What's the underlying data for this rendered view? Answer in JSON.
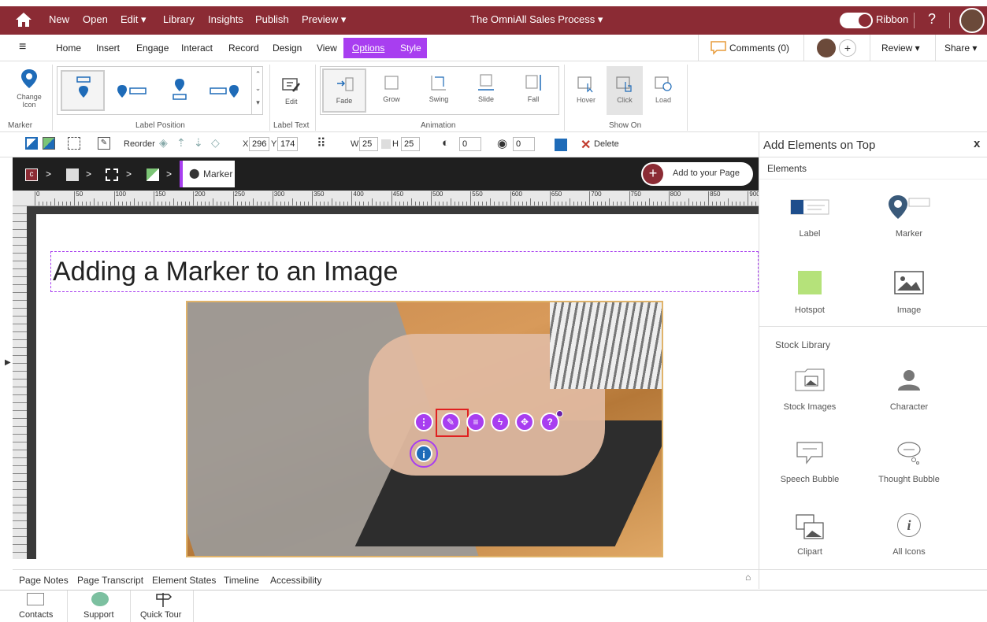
{
  "topbar": {
    "new": "New",
    "open": "Open",
    "edit": "Edit ▾",
    "library": "Library",
    "insights": "Insights",
    "publish": "Publish",
    "preview": "Preview ▾",
    "title": "The OmniAll Sales Process ▾",
    "ribbon": "Ribbon",
    "help": "?",
    "brand_color": "#8b2b34"
  },
  "tabs": {
    "home": "Home",
    "insert": "Insert",
    "engage": "Engage",
    "interact": "Interact",
    "record": "Record",
    "design": "Design",
    "view": "View",
    "options": "Options",
    "style": "Style",
    "comments": "Comments (0)",
    "review": "Review ▾",
    "share": "Share ▾",
    "accent": "#a83ef0"
  },
  "ribbon": {
    "change_icon": "Change Icon",
    "marker": "Marker",
    "label_position": "Label Position",
    "edit": "Edit",
    "label_text": "Label Text",
    "fade": "Fade",
    "grow": "Grow",
    "swing": "Swing",
    "slide": "Slide",
    "fall": "Fall",
    "animation": "Animation",
    "hover": "Hover",
    "click": "Click",
    "load": "Load",
    "show_on": "Show On"
  },
  "toolbar": {
    "reorder": "Reorder",
    "x_label": "X",
    "x": "296",
    "y_label": "Y",
    "y": "174",
    "w_label": "W",
    "w": "25",
    "h_label": "H",
    "h": "25",
    "opacity": "0",
    "rotate": "0",
    "delete": "Delete"
  },
  "crumb": {
    "marker": "Marker",
    "add": "Add to your Page"
  },
  "ruler": [
    "0",
    "50",
    "100",
    "150",
    "200",
    "250",
    "300",
    "350",
    "400",
    "450",
    "500",
    "550",
    "600",
    "650",
    "700",
    "750",
    "800",
    "850",
    "900"
  ],
  "page": {
    "heading": "Adding a Marker to an Image"
  },
  "panel": {
    "title": "Add Elements on Top",
    "close": "x",
    "elements": "Elements",
    "label": "Label",
    "marker": "Marker",
    "hotspot": "Hotspot",
    "image": "Image",
    "stock_library": "Stock Library",
    "stock_images": "Stock Images",
    "character": "Character",
    "speech": "Speech Bubble",
    "thought": "Thought Bubble",
    "clipart": "Clipart",
    "all_icons": "All Icons"
  },
  "bottomtabs": {
    "notes": "Page Notes",
    "transcript": "Page Transcript",
    "states": "Element States",
    "timeline": "Timeline",
    "accessibility": "Accessibility"
  },
  "bottombar": {
    "contacts": "Contacts",
    "support": "Support",
    "tour": "Quick Tour"
  }
}
